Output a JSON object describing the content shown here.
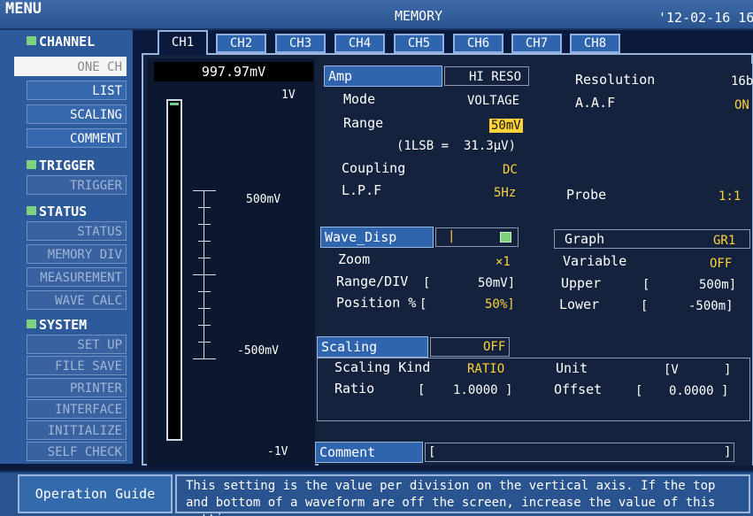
{
  "header": {
    "menu_label": "MENU",
    "screen_title": "MEMORY",
    "datetime": "'12-02-16 16"
  },
  "sidebar": {
    "channel_section": "CHANNEL",
    "channel_items": [
      "ONE CH",
      "LIST",
      "SCALING",
      "COMMENT"
    ],
    "trigger_section": "TRIGGER",
    "trigger_items": [
      "TRIGGER"
    ],
    "status_section": "STATUS",
    "status_items": [
      "STATUS",
      "MEMORY DIV",
      "MEASUREMENT",
      "WAVE CALC"
    ],
    "system_section": "SYSTEM",
    "system_items": [
      "SET UP",
      "FILE SAVE",
      "PRINTER",
      "INTERFACE",
      "INITIALIZE",
      "SELF CHECK"
    ]
  },
  "tabs": [
    "CH1",
    "CH2",
    "CH3",
    "CH4",
    "CH5",
    "CH6",
    "CH7",
    "CH8"
  ],
  "meter": {
    "value": "997.97mV",
    "scale_top": "1V",
    "scale_mid_upper": "500mV",
    "scale_mid_lower": "-500mV",
    "scale_bottom": "-1V"
  },
  "amp": {
    "header": "Amp",
    "mode_value_header": "HI RESO",
    "resolution_label": "Resolution",
    "resolution_value": "16b",
    "mode_label": "Mode",
    "mode_value": "VOLTAGE",
    "aaf_label": "A.A.F",
    "aaf_value": "ON",
    "range_label": "Range",
    "range_value": "50mV",
    "lsb_text": "(1LSB =",
    "lsb_value": "31.3µV)",
    "coupling_label": "Coupling",
    "coupling_value": "DC",
    "lpf_label": "L.P.F",
    "lpf_value": "5Hz",
    "probe_label": "Probe",
    "probe_value": "1:1"
  },
  "wave_disp": {
    "header": "Wave_Disp",
    "marker": "|",
    "graph_label": "Graph",
    "graph_value": "GR1",
    "zoom_label": "Zoom",
    "zoom_value": "×1",
    "variable_label": "Variable",
    "variable_value": "OFF",
    "range_div_label": "Range/DIV",
    "range_div_open": "[",
    "range_div_value": "50mV]",
    "upper_label": "Upper",
    "upper_open": "[",
    "upper_value": "500m]",
    "position_label": "Position %",
    "position_open": "[",
    "position_value": "50%]",
    "lower_label": "Lower",
    "lower_open": "[",
    "lower_value": "-500m]"
  },
  "scaling": {
    "header": "Scaling",
    "state": "OFF",
    "kind_label": "Scaling Kind",
    "kind_value": "RATIO",
    "unit_label": "Unit",
    "unit_open": "[V",
    "unit_close": "]",
    "ratio_label": "Ratio",
    "ratio_open": "[",
    "ratio_value": "1.0000 ]",
    "offset_label": "Offset",
    "offset_open": "[",
    "offset_value": "0.0000 ]"
  },
  "comment": {
    "label": "Comment",
    "open": "[",
    "close": "]"
  },
  "guide": {
    "title": "Operation Guide",
    "text": "This setting is the value per division on the vertical axis. If the top and bottom of a waveform are off the screen, increase the value of this setting."
  },
  "colors": {
    "accent_yellow": "#ffd23a",
    "panel_blue": "#2f64ae",
    "indicator_green": "#7ed27e"
  }
}
